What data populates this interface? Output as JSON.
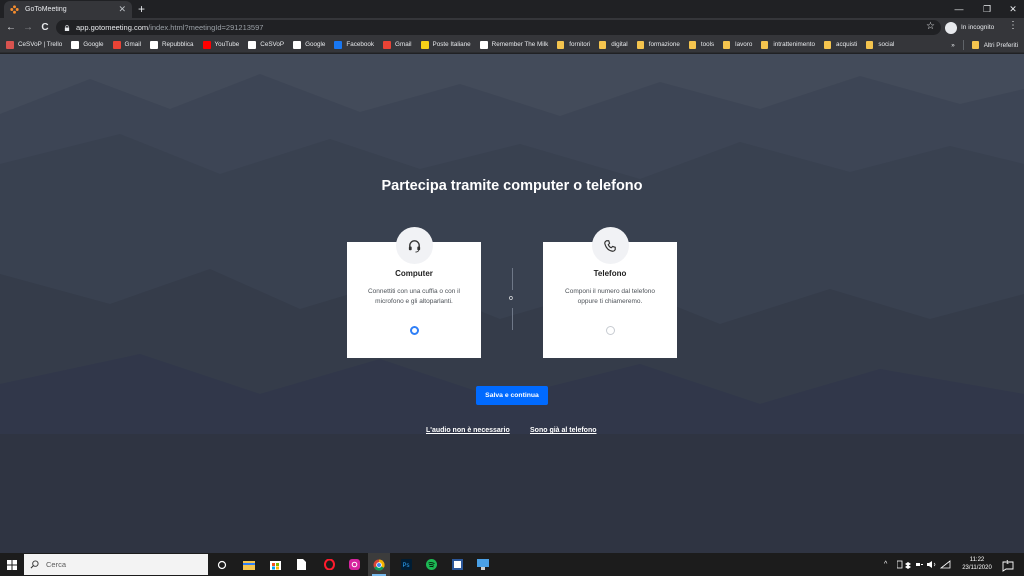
{
  "browser": {
    "tab": {
      "title": "GoToMeeting",
      "close": "✕"
    },
    "new_tab": "+",
    "window_controls": {
      "minimize": "—",
      "restore": "❐",
      "close": "✕"
    },
    "nav": {
      "back": "←",
      "forward": "→",
      "reload": "C"
    },
    "address": {
      "host": "app.gotomeeting.com",
      "path": "/index.html?meetingId=291213597"
    },
    "incognito_label": "In incognito",
    "bookmarks": [
      {
        "label": "CeSVoP | Trello",
        "icon": "trello-icon",
        "color": "#d9534f"
      },
      {
        "label": "Google",
        "icon": "google-icon",
        "color": "#ffffff"
      },
      {
        "label": "Gmail",
        "icon": "gmail-icon",
        "color": "#ea4335"
      },
      {
        "label": "Repubblica",
        "icon": "repubblica-icon",
        "color": "#ffffff"
      },
      {
        "label": "YouTube",
        "icon": "youtube-icon",
        "color": "#ff0000"
      },
      {
        "label": "CeSVoP",
        "icon": "cesvop-icon",
        "color": "#ffffff"
      },
      {
        "label": "Google",
        "icon": "google-icon",
        "color": "#ffffff"
      },
      {
        "label": "Facebook",
        "icon": "facebook-icon",
        "color": "#1877f2"
      },
      {
        "label": "Gmail",
        "icon": "gmail-icon",
        "color": "#ea4335"
      },
      {
        "label": "Poste Italiane",
        "icon": "poste-icon",
        "color": "#f7d117"
      },
      {
        "label": "Remember The Milk",
        "icon": "rtm-icon",
        "color": "#ffffff"
      },
      {
        "label": "fornitori",
        "icon": "folder-icon"
      },
      {
        "label": "digital",
        "icon": "folder-icon"
      },
      {
        "label": "formazione",
        "icon": "folder-icon"
      },
      {
        "label": "tools",
        "icon": "folder-icon"
      },
      {
        "label": "lavoro",
        "icon": "folder-icon"
      },
      {
        "label": "intrattenimento",
        "icon": "folder-icon"
      },
      {
        "label": "acquisti",
        "icon": "folder-icon"
      },
      {
        "label": "social",
        "icon": "folder-icon"
      }
    ],
    "bookmarks_overflow": "»",
    "other_bookmarks": "Altri Preferiti"
  },
  "page": {
    "heading": "Partecipa tramite computer o telefono",
    "options": [
      {
        "title": "Computer",
        "description": "Connettiti con una cuffia o con il microfono e gli altoparlanti.",
        "selected": true,
        "icon": "headset-icon"
      },
      {
        "title": "Telefono",
        "description": "Componi il numero dal telefono oppure ti chiameremo.",
        "selected": false,
        "icon": "phone-icon"
      }
    ],
    "divider_label": "o",
    "save_button": "Salva e continua",
    "links": {
      "no_audio": "L'audio non è necessario",
      "already_on_phone": "Sono già al telefono"
    },
    "colors": {
      "background": "#3f4756",
      "primary": "#006aff",
      "radio_selected": "#2f7ff7"
    }
  },
  "taskbar": {
    "search_placeholder": "Cerca",
    "apps": [
      "task-view",
      "file-explorer",
      "store",
      "notepad",
      "opera",
      "instagram",
      "chrome",
      "photoshop",
      "spotify",
      "word",
      "remote-desktop"
    ],
    "tray": {
      "chevron": "^"
    },
    "clock": {
      "time": "11:22",
      "date": "23/11/2020"
    },
    "notification_count": "1"
  }
}
